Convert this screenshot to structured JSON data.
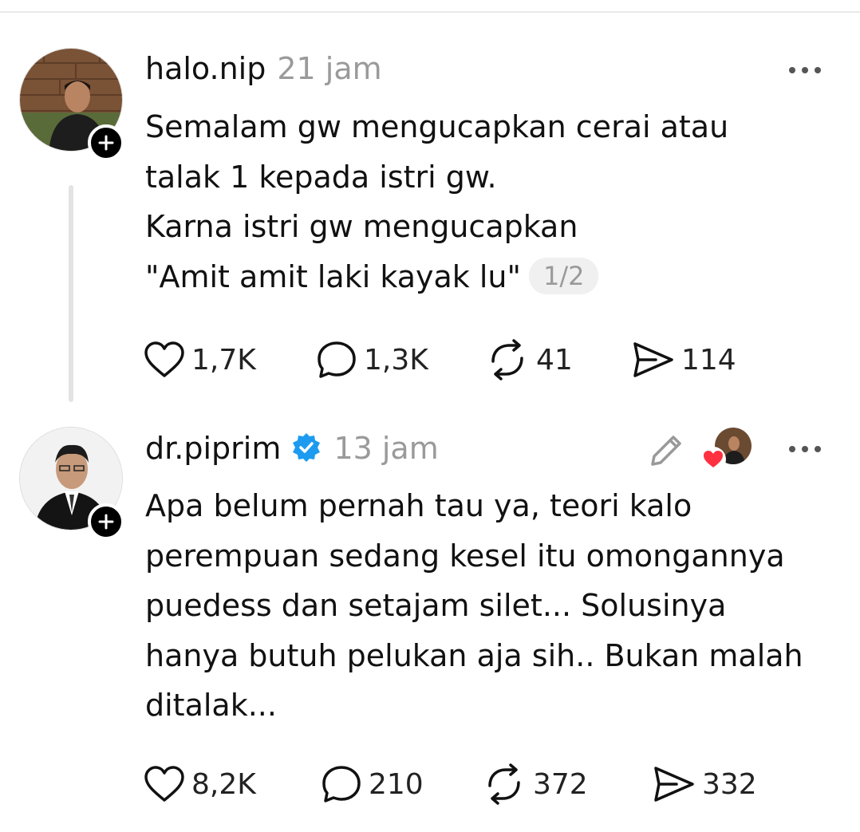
{
  "posts": [
    {
      "username": "halo.nip",
      "time": "21 jam",
      "text": "Semalam gw mengucapkan cerai atau\ntalak 1 kepada istri gw.\nKarna istri gw mengucapkan\n\"Amit amit laki kayak lu\"",
      "thread_indicator": "1/2",
      "likes": "1,7K",
      "replies": "1,3K",
      "reposts": "41",
      "shares": "114"
    },
    {
      "username": "dr.piprim",
      "time": "13 jam",
      "text": "Apa belum pernah tau ya, teori kalo\nperempuan sedang kesel itu omongannya\npuedess dan setajam silet... Solusinya\nhanya butuh pelukan aja sih.. Bukan malah\nditalak...",
      "likes": "8,2K",
      "replies": "210",
      "reposts": "372",
      "shares": "332"
    }
  ],
  "icons": {
    "more": "more-horizontal-icon",
    "follow": "plus-icon",
    "like": "heart-icon",
    "reply": "comment-bubble-icon",
    "repost": "repost-icon",
    "share": "send-icon",
    "edit": "pencil-icon",
    "verified": "verified-badge-icon"
  },
  "colors": {
    "verified": "#1d9bf0",
    "like_heart": "#ff3040",
    "muted": "#9a9a9a"
  }
}
